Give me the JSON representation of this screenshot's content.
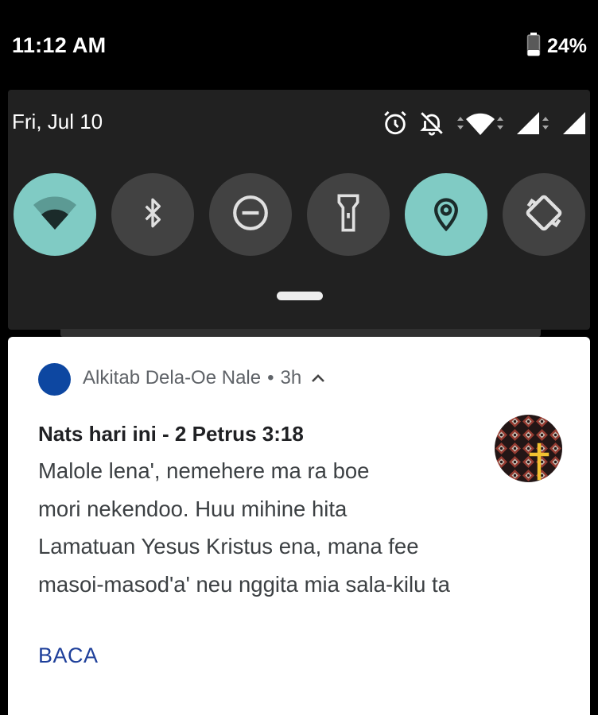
{
  "status_bar": {
    "time": "11:12 AM",
    "battery_percent": "24%",
    "battery_level": 0.24,
    "battery_icon": "battery-icon"
  },
  "quick_settings": {
    "date": "Fri, Jul 10",
    "status_icons": [
      "alarm-icon",
      "notifications-off-icon",
      "wifi-signal-icon",
      "cellular-signal-icon",
      "cellular-signal-icon"
    ],
    "tiles": [
      {
        "name": "wifi",
        "icon": "wifi-icon",
        "active": true
      },
      {
        "name": "bluetooth",
        "icon": "bluetooth-icon",
        "active": false
      },
      {
        "name": "do-not-disturb",
        "icon": "do-not-disturb-icon",
        "active": false
      },
      {
        "name": "flashlight",
        "icon": "flashlight-icon",
        "active": false
      },
      {
        "name": "location",
        "icon": "location-icon",
        "active": true
      },
      {
        "name": "auto-rotate",
        "icon": "auto-rotate-icon",
        "active": false
      }
    ],
    "active_color": "#80cbc4",
    "inactive_color": "#424242"
  },
  "notification": {
    "app_name": "Alkitab Dela-Oe Nale",
    "separator": "•",
    "time_ago": "3h",
    "app_color": "#0d47a1",
    "title": "Nats hari ini - 2 Petrus 3:18",
    "body_lines": [
      "Malole lena', nemehere ma ra boe",
      "mori nekendoo. Huu mihine hita",
      "Lamatuan Yesus Kristus ena, mana fee",
      "masoi-masod'a' neu nggita mia sala-kilu ta"
    ],
    "action_label": "BACA",
    "action_color": "#1e3f9a"
  }
}
